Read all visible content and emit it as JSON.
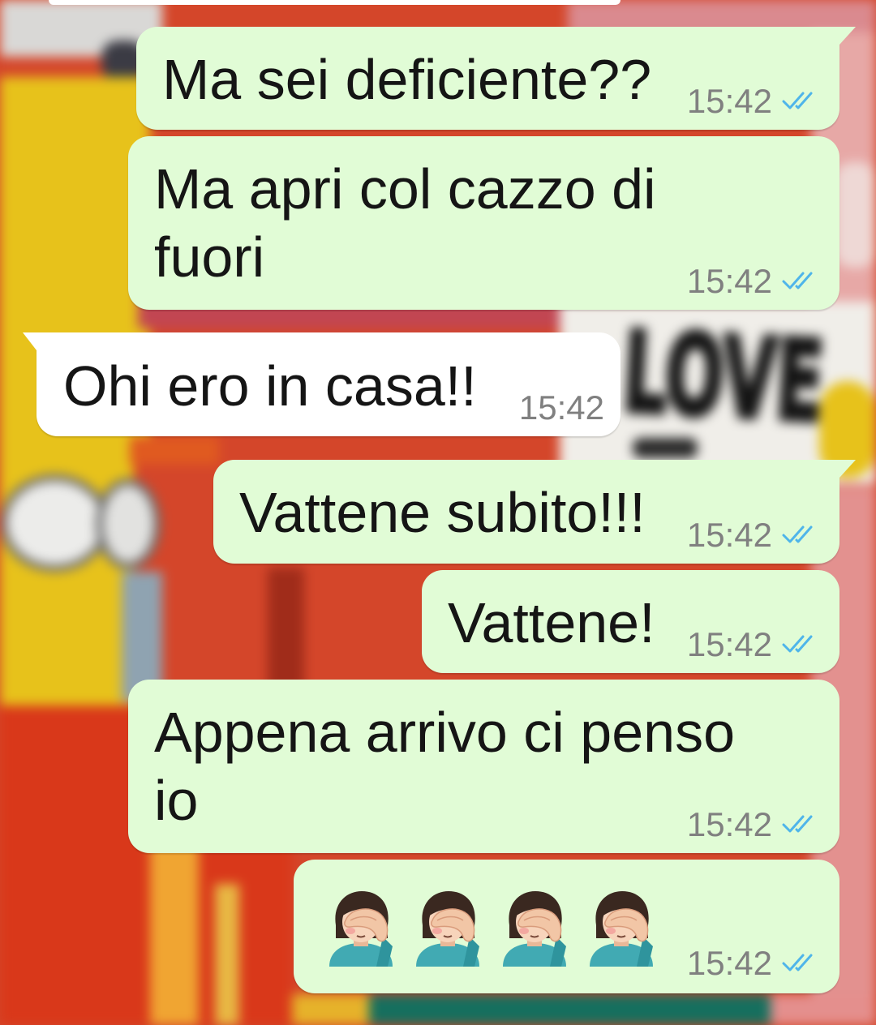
{
  "wallpaper": {
    "sign_text": "LOVE"
  },
  "colors": {
    "outgoing_bubble": "#e1fcd6",
    "incoming_bubble": "#ffffff",
    "timestamp": "#808080",
    "read_ticks": "#4fb5ea"
  },
  "messages": [
    {
      "outgoing": true,
      "text": "Ma sei deficiente??",
      "time": "15:42",
      "status_icon": "double-check-read-icon"
    },
    {
      "outgoing": true,
      "text": "Ma apri col cazzo di fuori",
      "time": "15:42",
      "status_icon": "double-check-read-icon"
    },
    {
      "outgoing": false,
      "text": "Ohi ero in casa!!",
      "time": "15:42"
    },
    {
      "outgoing": true,
      "text": "Vattene subito!!!",
      "time": "15:42",
      "status_icon": "double-check-read-icon"
    },
    {
      "outgoing": true,
      "text": "Vattene!",
      "time": "15:42",
      "status_icon": "double-check-read-icon"
    },
    {
      "outgoing": true,
      "text": "Appena arrivo ci penso io",
      "time": "15:42",
      "status_icon": "double-check-read-icon"
    },
    {
      "outgoing": true,
      "emojis": [
        "woman-facepalming-emoji",
        "woman-facepalming-emoji",
        "woman-facepalming-emoji",
        "woman-facepalming-emoji"
      ],
      "time": "15:42",
      "status_icon": "double-check-read-icon"
    }
  ]
}
